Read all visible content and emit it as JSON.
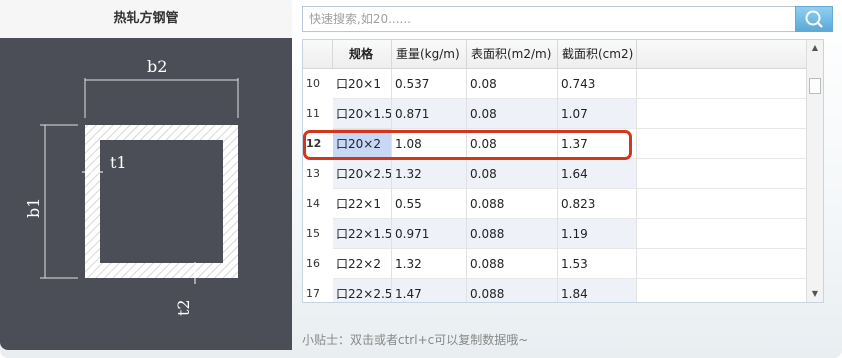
{
  "title": "热轧方钢管",
  "search": {
    "placeholder": "快速搜索,如20......",
    "icon": "search-icon"
  },
  "diagram": {
    "labels": {
      "b2": "b2",
      "b1": "b1",
      "t1": "t1",
      "t2": "t2"
    },
    "colors": {
      "background": "#4b4e57",
      "section": "#ffffff"
    }
  },
  "table": {
    "headers": [
      "规格",
      "重量(kg/m)",
      "表面积(m2/m)",
      "截面积(cm2)"
    ],
    "rows": [
      {
        "n": "10",
        "spec": "口20×1",
        "weight": "0.537",
        "surface": "0.08",
        "area": "0.743"
      },
      {
        "n": "11",
        "spec": "口20×1.5",
        "weight": "0.871",
        "surface": "0.08",
        "area": "1.07"
      },
      {
        "n": "12",
        "spec": "口20×2",
        "weight": "1.08",
        "surface": "0.08",
        "area": "1.37"
      },
      {
        "n": "13",
        "spec": "口20×2.5",
        "weight": "1.32",
        "surface": "0.08",
        "area": "1.64"
      },
      {
        "n": "14",
        "spec": "口22×1",
        "weight": "0.55",
        "surface": "0.088",
        "area": "0.823"
      },
      {
        "n": "15",
        "spec": "口22×1.5",
        "weight": "0.971",
        "surface": "0.088",
        "area": "1.19"
      },
      {
        "n": "16",
        "spec": "口22×2",
        "weight": "1.32",
        "surface": "0.088",
        "area": "1.53"
      },
      {
        "n": "17",
        "spec": "口22×2.5",
        "weight": "1.47",
        "surface": "0.088",
        "area": "1.84"
      }
    ],
    "selected_row": "12",
    "highlight_color": "#d0371c"
  },
  "tip": "小贴士：双击或者ctrl+c可以复制数据哦~"
}
